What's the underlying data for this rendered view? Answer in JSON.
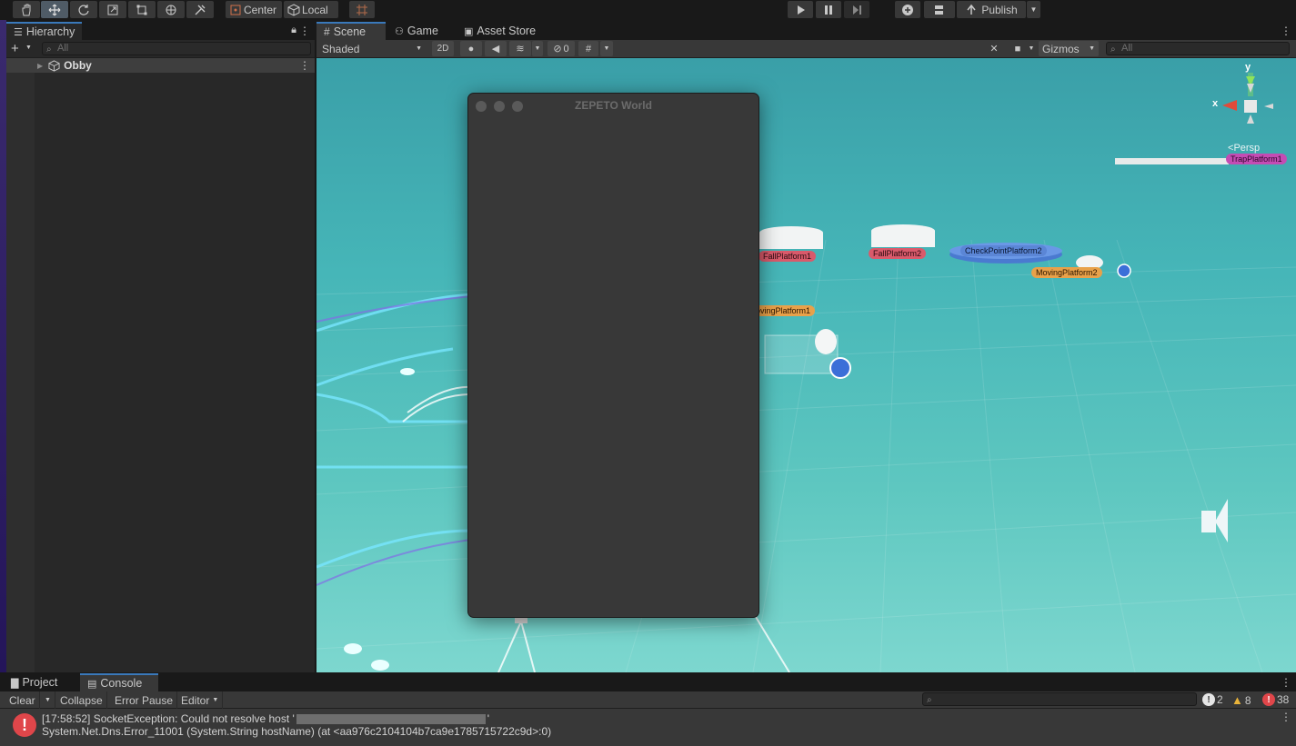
{
  "toolbar": {
    "tools": [
      "hand-tool",
      "move-tool",
      "rotate-tool",
      "scale-tool",
      "rect-tool",
      "transform-tool",
      "custom-tool"
    ],
    "pivot_label": "Center",
    "space_label": "Local",
    "publish_label": "Publish"
  },
  "hierarchy": {
    "tab_label": "Hierarchy",
    "search_placeholder": "All",
    "root_item": "Obby"
  },
  "scene": {
    "tabs": [
      "Scene",
      "Game",
      "Asset Store"
    ],
    "shading_mode": "Shaded",
    "mode_2d": "2D",
    "hidden_count": "0",
    "gizmos_label": "Gizmos",
    "search_placeholder": "All",
    "persp_label": "Persp",
    "axis_x": "x",
    "axis_y": "y",
    "platform_labels": {
      "fall1": "FallPlatform1",
      "fall2": "FallPlatform2",
      "checkpoint2": "CheckPointPlatform2",
      "moving2": "MovingPlatform2",
      "moving1": "ovingPlatform1",
      "trap1": "TrapPlatform1"
    }
  },
  "zepeto_window": {
    "title": "ZEPETO World"
  },
  "bottom": {
    "tabs": [
      "Project",
      "Console"
    ],
    "clear_label": "Clear",
    "collapse_label": "Collapse",
    "error_pause_label": "Error Pause",
    "editor_label": "Editor",
    "counts": {
      "info": "2",
      "warnings": "8",
      "errors": "38"
    },
    "message_line1_prefix": "[17:58:52] SocketException: Could not resolve host '",
    "message_line1_suffix": "'",
    "message_line2": "System.Net.Dns.Error_11001 (System.String hostName) (at <aa976c2104104b7ca9e1785715722c9d>:0)"
  },
  "colors": {
    "accent": "#3a79bb",
    "error": "#e0464a",
    "warning": "#e8b33a",
    "viewport_top": "#3a9fa8"
  }
}
